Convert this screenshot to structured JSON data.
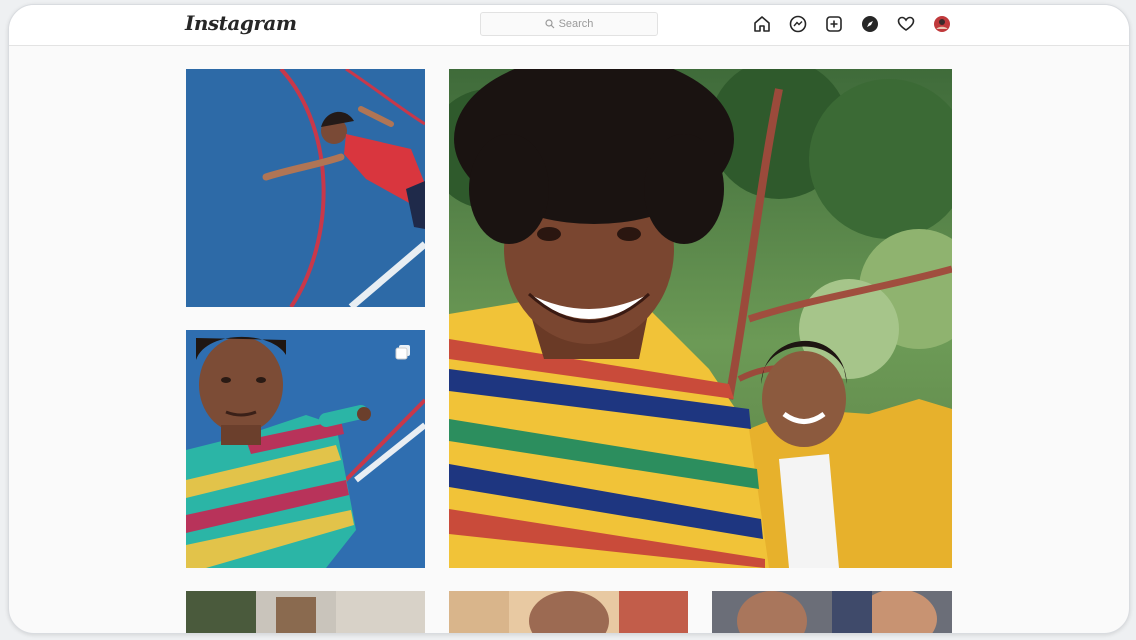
{
  "app": {
    "logo_text": "Instagram",
    "search_placeholder": "Search"
  },
  "nav_icons": [
    "home-icon",
    "messenger-icon",
    "new-post-icon",
    "explore-icon",
    "heart-icon",
    "profile-avatar"
  ],
  "colors": {
    "topbar_bg": "#ffffff",
    "page_bg": "#fafafa",
    "text_dark": "#262626",
    "muted": "#9a9a9a"
  },
  "grid": {
    "tiles": [
      {
        "name": "post-lying-court",
        "description": "Person lying on blue sports court"
      },
      {
        "name": "post-striped-shirt-portrait",
        "description": "Person in striped shirt on blue court",
        "carousel": true
      },
      {
        "name": "post-selfie-two-friends",
        "description": "Two friends smiling selfie under a tree"
      },
      {
        "name": "post-bottom-1"
      },
      {
        "name": "post-bottom-2"
      },
      {
        "name": "post-bottom-3"
      }
    ]
  }
}
